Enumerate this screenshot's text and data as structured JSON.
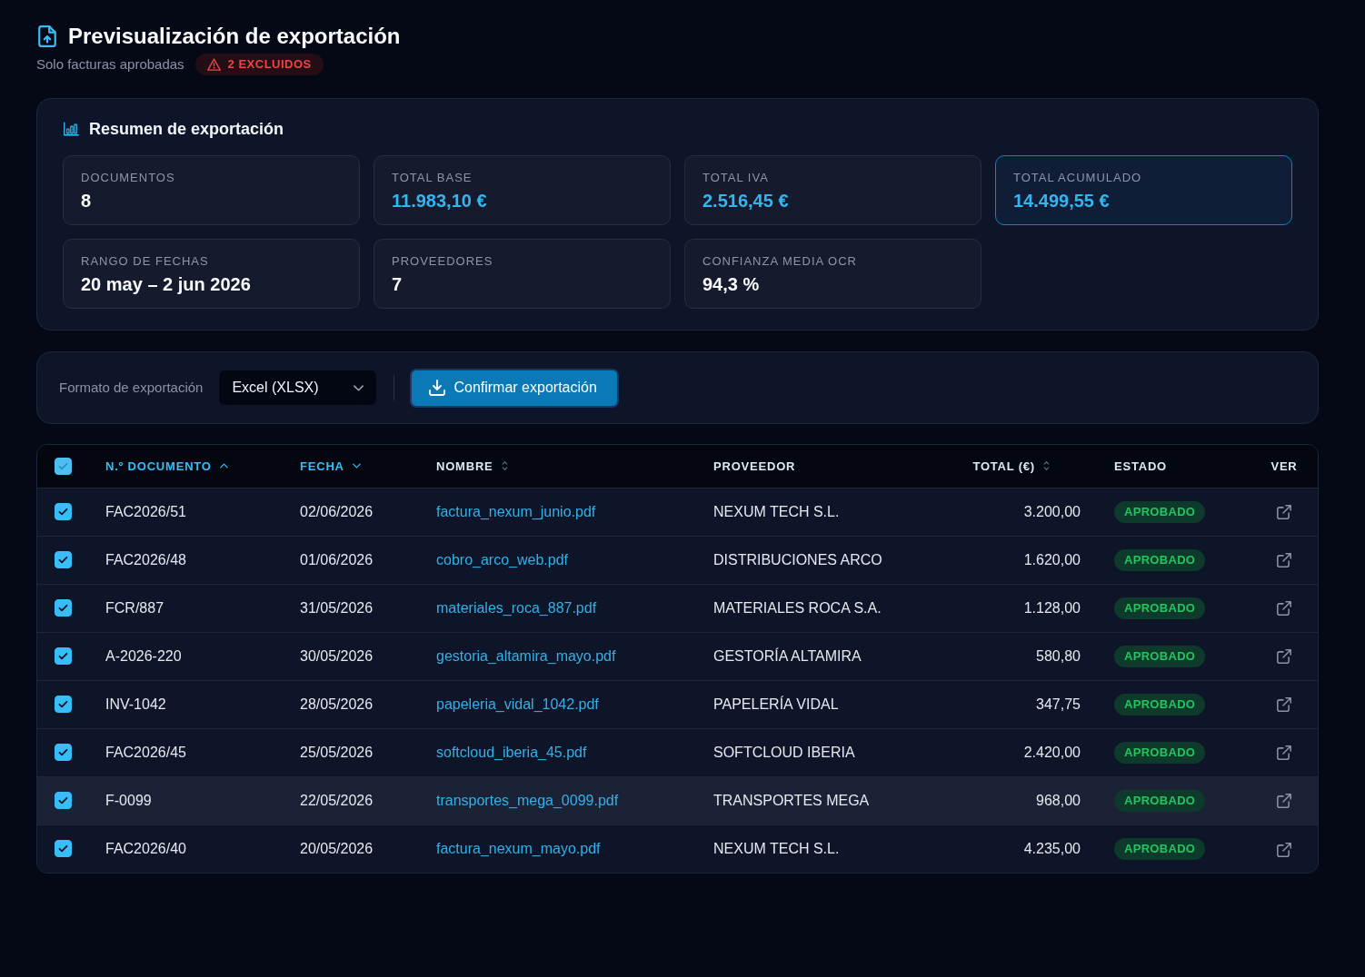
{
  "page": {
    "title": "Previsualización de exportación",
    "subtitle": "Solo facturas aprobadas",
    "excluded_badge": "2 EXCLUIDOS"
  },
  "summary": {
    "title": "Resumen de exportación",
    "stats": [
      {
        "label": "DOCUMENTOS",
        "value": "8",
        "kind": "plain",
        "highlighted": false
      },
      {
        "label": "TOTAL BASE",
        "value": "11.983,10 €",
        "kind": "amount",
        "highlighted": false
      },
      {
        "label": "TOTAL IVA",
        "value": "2.516,45 €",
        "kind": "amount",
        "highlighted": false
      },
      {
        "label": "TOTAL ACUMULADO",
        "value": "14.499,55 €",
        "kind": "amount",
        "highlighted": true
      },
      {
        "label": "RANGO DE FECHAS",
        "value": "20 may – 2 jun 2026",
        "kind": "plain",
        "highlighted": false
      },
      {
        "label": "PROVEEDORES",
        "value": "7",
        "kind": "plain",
        "highlighted": false
      },
      {
        "label": "CONFIANZA MEDIA OCR",
        "value": "94,3 %",
        "kind": "plain",
        "highlighted": false
      }
    ]
  },
  "export_toolbar": {
    "format_label": "Formato de exportación",
    "format_value": "Excel (XLSX)",
    "confirm_button": "Confirmar exportación"
  },
  "table": {
    "select_all": {
      "checked": true
    },
    "columns": [
      {
        "label": "N.º DOCUMENTO",
        "kind": "ascending"
      },
      {
        "label": "FECHA",
        "kind": "descending"
      },
      {
        "label": "NOMBRE",
        "kind": "sortable"
      },
      {
        "label": "PROVEEDOR",
        "kind": "plain"
      },
      {
        "label": "TOTAL (€)",
        "kind": "sortable"
      },
      {
        "label": "ESTADO",
        "kind": "plain"
      },
      {
        "label": "VER",
        "kind": "plain"
      }
    ],
    "rows": [
      {
        "selected": true,
        "highlighted": false,
        "document": "FAC2026/51",
        "date": "02/06/2026",
        "file": "factura_nexum_junio.pdf",
        "supplier": "NEXUM TECH S.L.",
        "total": "3.200,00",
        "status": {
          "label": "APROBADO",
          "kind": "approved"
        }
      },
      {
        "selected": true,
        "highlighted": false,
        "document": "FAC2026/48",
        "date": "01/06/2026",
        "file": "cobro_arco_web.pdf",
        "supplier": "DISTRIBUCIONES ARCO",
        "total": "1.620,00",
        "status": {
          "label": "APROBADO",
          "kind": "approved"
        }
      },
      {
        "selected": true,
        "highlighted": false,
        "document": "FCR/887",
        "date": "31/05/2026",
        "file": "materiales_roca_887.pdf",
        "supplier": "MATERIALES ROCA S.A.",
        "total": "1.128,00",
        "status": {
          "label": "APROBADO",
          "kind": "approved"
        }
      },
      {
        "selected": true,
        "highlighted": false,
        "document": "A-2026-220",
        "date": "30/05/2026",
        "file": "gestoria_altamira_mayo.pdf",
        "supplier": "GESTORÍA ALTAMIRA",
        "total": "580,80",
        "status": {
          "label": "APROBADO",
          "kind": "approved"
        }
      },
      {
        "selected": true,
        "highlighted": false,
        "document": "INV-1042",
        "date": "28/05/2026",
        "file": "papeleria_vidal_1042.pdf",
        "supplier": "PAPELERÍA VIDAL",
        "total": "347,75",
        "status": {
          "label": "APROBADO",
          "kind": "approved"
        }
      },
      {
        "selected": true,
        "highlighted": false,
        "document": "FAC2026/45",
        "date": "25/05/2026",
        "file": "softcloud_iberia_45.pdf",
        "supplier": "SOFTCLOUD IBERIA",
        "total": "2.420,00",
        "status": {
          "label": "APROBADO",
          "kind": "approved"
        }
      },
      {
        "selected": true,
        "highlighted": true,
        "document": "F-0099",
        "date": "22/05/2026",
        "file": "transportes_mega_0099.pdf",
        "supplier": "TRANSPORTES MEGA",
        "total": "968,00",
        "status": {
          "label": "APROBADO",
          "kind": "approved"
        }
      },
      {
        "selected": true,
        "highlighted": false,
        "document": "FAC2026/40",
        "date": "20/05/2026",
        "file": "factura_nexum_mayo.pdf",
        "supplier": "NEXUM TECH S.L.",
        "total": "4.235,00",
        "status": {
          "label": "APROBADO",
          "kind": "approved"
        }
      }
    ]
  }
}
